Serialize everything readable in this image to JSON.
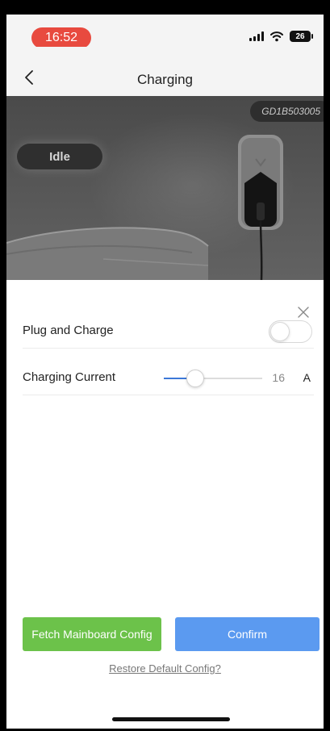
{
  "status_bar": {
    "time": "16:52",
    "battery": "26",
    "time_pill_color": "#e84a3f"
  },
  "nav": {
    "title": "Charging",
    "back_icon": "chevron-left-icon"
  },
  "hero": {
    "serial_number": "GD1B503005",
    "status": "Idle"
  },
  "settings": {
    "close_icon": "close-icon",
    "plug_and_charge": {
      "label": "Plug and Charge",
      "enabled": false
    },
    "charging_current": {
      "label": "Charging Current",
      "value": "16",
      "unit": "A",
      "slider_fraction": 0.32,
      "accent_color": "#3c78d8"
    }
  },
  "actions": {
    "fetch_label": "Fetch Mainboard Config",
    "fetch_color": "#6cc24a",
    "confirm_label": "Confirm",
    "confirm_color": "#5b9af0",
    "restore_label": "Restore Default Config?"
  }
}
